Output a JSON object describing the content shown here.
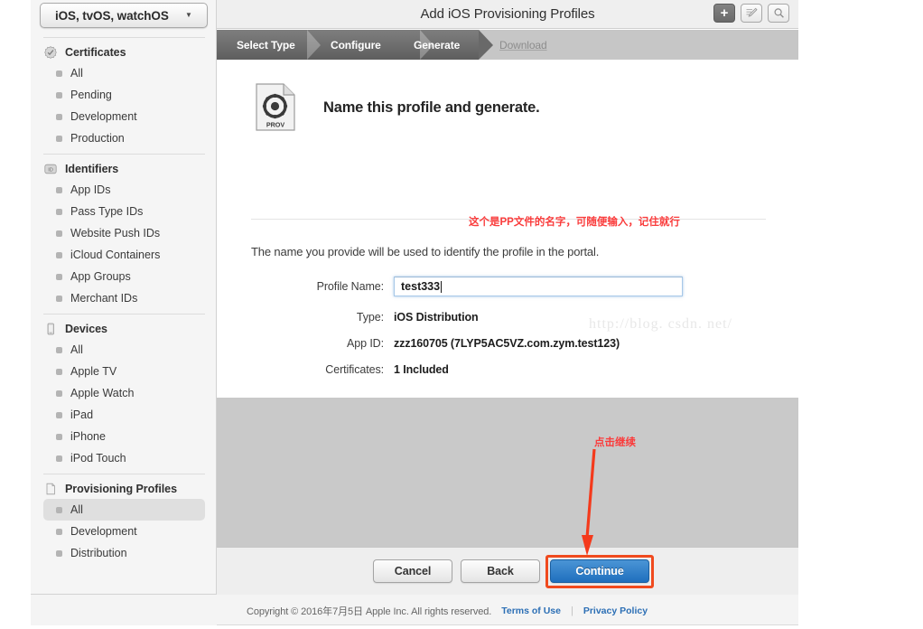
{
  "sidebar": {
    "team_selector": {
      "value": "iOS, tvOS, watchOS",
      "icon": "chevron-down-icon"
    },
    "sections": [
      {
        "label": "Certificates",
        "icon": "certificate-seal-icon",
        "items": [
          {
            "label": "All",
            "selected": false
          },
          {
            "label": "Pending",
            "selected": false
          },
          {
            "label": "Development",
            "selected": false
          },
          {
            "label": "Production",
            "selected": false
          }
        ]
      },
      {
        "label": "Identifiers",
        "icon": "id-badge-icon",
        "items": [
          {
            "label": "App IDs",
            "selected": false
          },
          {
            "label": "Pass Type IDs",
            "selected": false
          },
          {
            "label": "Website Push IDs",
            "selected": false
          },
          {
            "label": "iCloud Containers",
            "selected": false
          },
          {
            "label": "App Groups",
            "selected": false
          },
          {
            "label": "Merchant IDs",
            "selected": false
          }
        ]
      },
      {
        "label": "Devices",
        "icon": "device-phone-icon",
        "items": [
          {
            "label": "All",
            "selected": false
          },
          {
            "label": "Apple TV",
            "selected": false
          },
          {
            "label": "Apple Watch",
            "selected": false
          },
          {
            "label": "iPad",
            "selected": false
          },
          {
            "label": "iPhone",
            "selected": false
          },
          {
            "label": "iPod Touch",
            "selected": false
          }
        ]
      },
      {
        "label": "Provisioning Profiles",
        "icon": "document-icon",
        "items": [
          {
            "label": "All",
            "selected": true
          },
          {
            "label": "Development",
            "selected": false
          },
          {
            "label": "Distribution",
            "selected": false
          }
        ]
      }
    ]
  },
  "header": {
    "title": "Add iOS Provisioning Profiles",
    "toolbar": [
      {
        "name": "add-button",
        "icon": "plus-icon",
        "label": "+",
        "active": true
      },
      {
        "name": "edit-button",
        "icon": "edit-pencil-icon",
        "label": ""
      },
      {
        "name": "search-button",
        "icon": "search-icon",
        "label": ""
      }
    ]
  },
  "steps": [
    {
      "label": "Select Type",
      "state": "done"
    },
    {
      "label": "Configure",
      "state": "done"
    },
    {
      "label": "Generate",
      "state": "current"
    },
    {
      "label": "Download",
      "state": "upcoming"
    }
  ],
  "content": {
    "icon": "provisioning-profile-file-icon",
    "icon_caption": "PROV",
    "heading": "Name this profile and generate.",
    "intro": "The name you provide will be used to identify the profile in the portal.",
    "fields": [
      {
        "label": "Profile Name:",
        "value": "test333",
        "type": "input",
        "focused": true
      },
      {
        "label": "Type:",
        "value": "iOS Distribution",
        "type": "static"
      },
      {
        "label": "App ID:",
        "value": "zzz160705 (7LYP5AC5VZ.com.zym.test123)",
        "type": "static"
      },
      {
        "label": "Certificates:",
        "value": "1 Included",
        "type": "static"
      }
    ],
    "watermark": "http://blog. csdn. net/"
  },
  "actions": {
    "cancel_label": "Cancel",
    "back_label": "Back",
    "continue_label": "Continue",
    "continue_highlighted": true
  },
  "annotations": [
    {
      "name": "profile-name-note",
      "text": "这个是PP文件的名字，可随便输入，记住就行",
      "color": "#fa3c3c"
    },
    {
      "name": "click-continue-note",
      "text": "点击继续",
      "color": "#fa3c3c"
    }
  ],
  "footer": {
    "copyright": "Copyright © 2016年7月5日 Apple Inc. All rights reserved.",
    "terms_label": "Terms of Use",
    "privacy_label": "Privacy Policy",
    "separator": "|"
  },
  "colors": {
    "accent_blue": "#1f6fbd",
    "annotation_red": "#fa3c3c",
    "highlight_orange": "#f04a1e",
    "link_blue": "#2c6fb5",
    "step_active": "#696969",
    "step_bar": "#c6c6c6"
  }
}
